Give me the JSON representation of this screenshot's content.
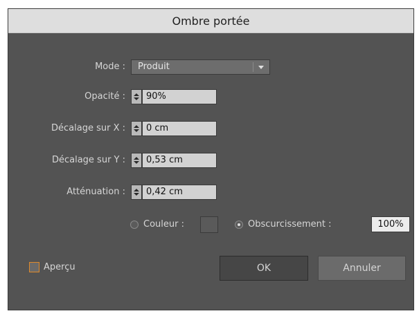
{
  "dialog": {
    "title": "Ombre portée",
    "mode": {
      "label": "Mode :",
      "value": "Produit"
    },
    "opacity": {
      "label": "Opacité :",
      "value": "90%"
    },
    "offset_x": {
      "label": "Décalage sur X :",
      "value": "0 cm"
    },
    "offset_y": {
      "label": "Décalage sur Y :",
      "value": "0,53 cm"
    },
    "blur": {
      "label": "Atténuation :",
      "value": "0,42 cm"
    },
    "color_option": {
      "label": "Couleur :",
      "selected": false
    },
    "darkness_option": {
      "label": "Obscurcissement :",
      "value": "100%",
      "selected": true
    },
    "preview": {
      "label": "Aperçu",
      "checked": false
    },
    "ok_label": "OK",
    "cancel_label": "Annuler"
  },
  "colors": {
    "panel": "#535353",
    "titlebar": "#dedede",
    "checkbox_accent": "#e08a2a"
  }
}
